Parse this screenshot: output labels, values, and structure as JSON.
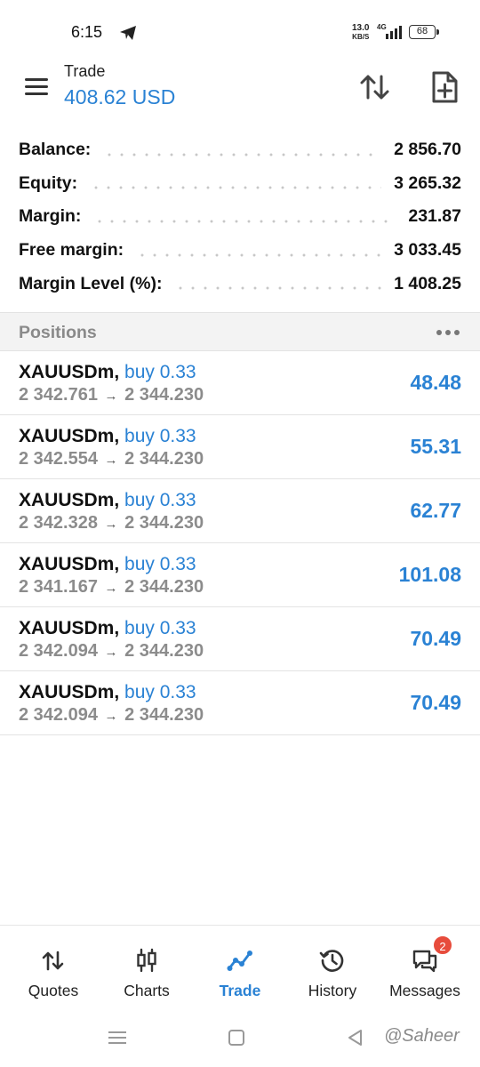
{
  "status_bar": {
    "time": "6:15",
    "speed_value": "13.0",
    "speed_unit": "KB/S",
    "network": "4G",
    "battery": "68"
  },
  "header": {
    "title": "Trade",
    "subtitle": "408.62 USD"
  },
  "summary": {
    "items": [
      {
        "label": "Balance:",
        "value": "2 856.70"
      },
      {
        "label": "Equity:",
        "value": "3 265.32"
      },
      {
        "label": "Margin:",
        "value": "231.87"
      },
      {
        "label": "Free margin:",
        "value": "3 033.45"
      },
      {
        "label": "Margin Level (%):",
        "value": "1 408.25"
      }
    ]
  },
  "positions": {
    "title": "Positions",
    "arrow": "→",
    "items": [
      {
        "symbol": "XAUUSDm,",
        "type": "buy 0.33",
        "open_price": "2 342.761",
        "current_price": "2 344.230",
        "profit": "48.48"
      },
      {
        "symbol": "XAUUSDm,",
        "type": "buy 0.33",
        "open_price": "2 342.554",
        "current_price": "2 344.230",
        "profit": "55.31"
      },
      {
        "symbol": "XAUUSDm,",
        "type": "buy 0.33",
        "open_price": "2 342.328",
        "current_price": "2 344.230",
        "profit": "62.77"
      },
      {
        "symbol": "XAUUSDm,",
        "type": "buy 0.33",
        "open_price": "2 341.167",
        "current_price": "2 344.230",
        "profit": "101.08"
      },
      {
        "symbol": "XAUUSDm,",
        "type": "buy 0.33",
        "open_price": "2 342.094",
        "current_price": "2 344.230",
        "profit": "70.49"
      },
      {
        "symbol": "XAUUSDm,",
        "type": "buy 0.33",
        "open_price": "2 342.094",
        "current_price": "2 344.230",
        "profit": "70.49"
      }
    ]
  },
  "bottom_nav": {
    "items": [
      {
        "label": "Quotes",
        "icon": "quotes-arrows-icon"
      },
      {
        "label": "Charts",
        "icon": "candlestick-icon"
      },
      {
        "label": "Trade",
        "icon": "trade-line-icon",
        "active": true
      },
      {
        "label": "History",
        "icon": "history-clock-icon"
      },
      {
        "label": "Messages",
        "icon": "chat-bubbles-icon",
        "badge": "2"
      }
    ]
  },
  "watermark": "@Saheer",
  "colors": {
    "accent": "#2a82d4",
    "badge": "#e74c3c",
    "muted": "#8c8c8c"
  }
}
